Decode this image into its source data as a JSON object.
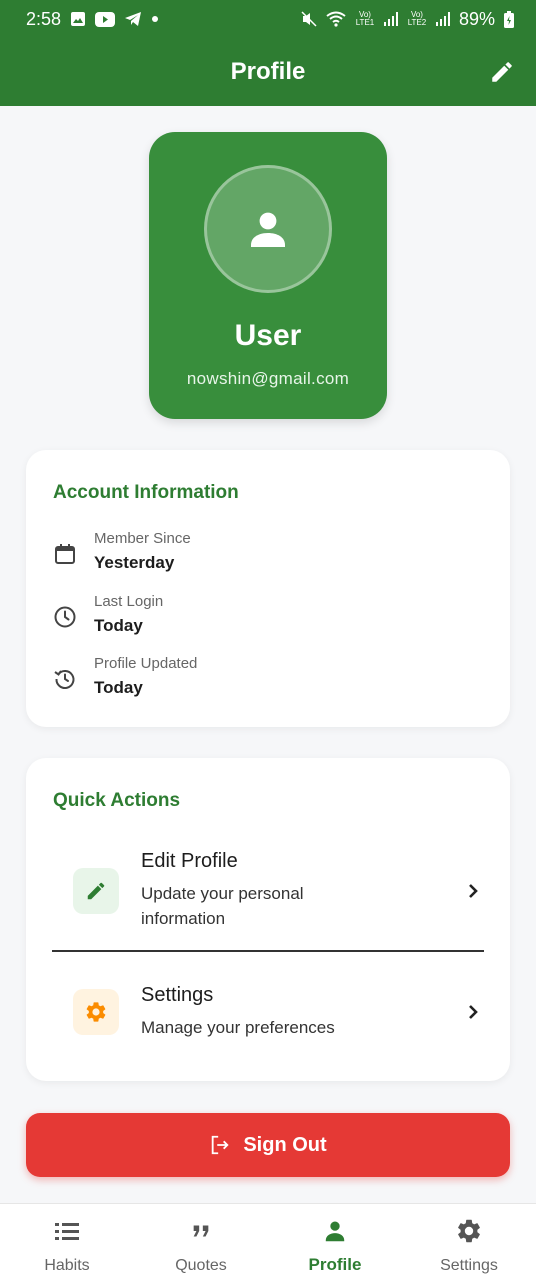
{
  "status_bar": {
    "time": "2:58",
    "battery": "89%",
    "sim1": "Vo) LTE1",
    "sim2": "Vo) LTE2"
  },
  "app_bar": {
    "title": "Profile"
  },
  "profile": {
    "name": "User",
    "email": "nowshin@gmail.com"
  },
  "account": {
    "title": "Account Information",
    "items": [
      {
        "icon": "calendar-icon",
        "label": "Member Since",
        "value": "Yesterday"
      },
      {
        "icon": "clock-icon",
        "label": "Last Login",
        "value": "Today"
      },
      {
        "icon": "history-icon",
        "label": "Profile Updated",
        "value": "Today"
      }
    ]
  },
  "quick_actions": {
    "title": "Quick Actions",
    "items": [
      {
        "icon": "pencil-icon",
        "title": "Edit Profile",
        "subtitle": "Update your personal information",
        "icon_bg": "#e8f5e9",
        "icon_color": "#2e7d32"
      },
      {
        "icon": "gear-icon",
        "title": "Settings",
        "subtitle": "Manage your preferences",
        "icon_bg": "#fff3e0",
        "icon_color": "#fb8c00"
      }
    ]
  },
  "sign_out": {
    "label": "Sign Out"
  },
  "bottom_nav": {
    "items": [
      {
        "icon": "list-icon",
        "label": "Habits",
        "active": false
      },
      {
        "icon": "quote-icon",
        "label": "Quotes",
        "active": false
      },
      {
        "icon": "person-icon",
        "label": "Profile",
        "active": true
      },
      {
        "icon": "gear-icon",
        "label": "Settings",
        "active": false
      }
    ]
  },
  "colors": {
    "primary": "#2e7d32",
    "card_green": "#388e3c",
    "danger": "#e53935",
    "background": "#f6f7f9"
  }
}
